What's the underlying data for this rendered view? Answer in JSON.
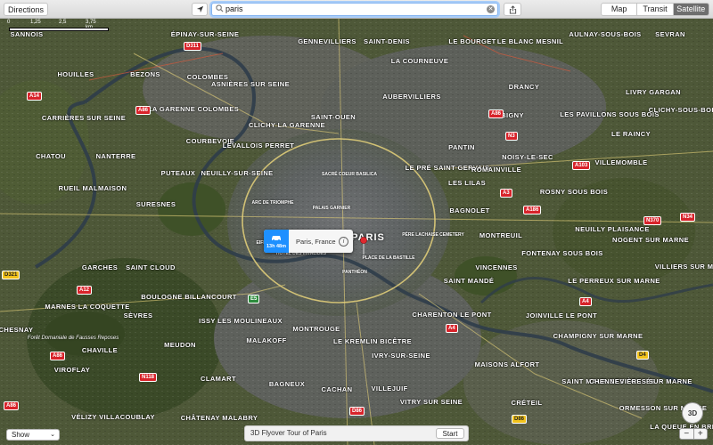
{
  "toolbar": {
    "directions_label": "Directions",
    "search_value": "paris",
    "map_types": [
      "Map",
      "Transit",
      "Satellite"
    ],
    "active_map_type": "Satellite"
  },
  "scale": {
    "ticks": [
      "0",
      "1,25",
      "2,5",
      "3,75 km"
    ]
  },
  "map": {
    "city_label": "PARIS",
    "places": [
      "SANNOIS",
      "GENNEVILLIERS",
      "SAINT-DENIS",
      "LE BOURGET",
      "LE BLANC MESNIL",
      "AULNAY-SOUS-BOIS",
      "SEVRAN",
      "ÉPINAY-SUR-SEINE",
      "HOUILLES",
      "BEZONS",
      "COLOMBES",
      "ASNIÈRES SUR SEINE",
      "LA COURNEUVE",
      "DRANCY",
      "LIVRY GARGAN",
      "AUBERVILLIERS",
      "BOBIGNY",
      "LES PAVILLONS SOUS BOIS",
      "CLICHY-SOUS-BOIS",
      "CARRIÈRES SUR SEINE",
      "LA GARENNE COLOMBES",
      "CLICHY LA GARENNE",
      "SAINT-OUEN",
      "LE RAINCY",
      "PANTIN",
      "NOISY-LE-SEC",
      "CHATOU",
      "NANTERRE",
      "COURBEVOIE",
      "LEVALLOIS PERRET",
      "LE PRÉ SAINT GERVAIS",
      "ROMAINVILLE",
      "VILLEMOMBLE",
      "RUEIL MALMAISON",
      "PUTEAUX",
      "NEUILLY-SUR-SEINE",
      "LES LILAS",
      "ROSNY SOUS BOIS",
      "SURESNES",
      "BAGNOLET",
      "NEUILLY PLAISANCE",
      "NOGENT SUR MARNE",
      "MONTREUIL",
      "FONTENAY SOUS BOIS",
      "GARCHES",
      "SAINT CLOUD",
      "VINCENNES",
      "VILLIERS SUR MARNE",
      "LE PERREUX SUR MARNE",
      "BOULOGNE BILLANCOURT",
      "SAINT MANDÉ",
      "MARNES LA COQUETTE",
      "SÈVRES",
      "ISSY LES MOULINEAUX",
      "CHARENTON LE PONT",
      "JOINVILLE LE PONT",
      "CHAMPIGNY SUR MARNE",
      "CHESNAY",
      "CHAVILLE",
      "MEUDON",
      "MALAKOFF",
      "MONTROUGE",
      "LE KREMLIN BICÊTRE",
      "IVRY-SUR-SEINE",
      "MAISONS ALFORT",
      "VIROFLAY",
      "CLAMART",
      "BAGNEUX",
      "CACHAN",
      "VILLEJUIF",
      "VITRY SUR SEINE",
      "CRÉTEIL",
      "SAINT MAUR DES FOSSÉS",
      "CHENNEVIÈRES SUR MARNE",
      "VÉLIZY VILLACOUBLAY",
      "CHÂTENAY MALABRY",
      "ORMESSON SUR MARNE",
      "LA QUEUE EN BRIE"
    ],
    "pois": [
      "SACRÉ COEUR BASILICA",
      "ARC DE TRIOMPHE",
      "PALAIS GARNIER",
      "EIFFEL TOWER",
      "HÔTEL DES INVALIDES",
      "PLACE DE LA BASTILLE",
      "PANTHÉON",
      "PÈRE LACHAISE CEMETERY"
    ],
    "park_label": "Forêt Domaniale de Fausses Reposes"
  },
  "callout": {
    "eta": "13h 48m",
    "place": "Paris, France"
  },
  "bottom": {
    "show_label": "Show",
    "flyover_label": "3D Flyover Tour of Paris",
    "start_label": "Start",
    "btn_3d": "3D",
    "zoom_out": "−",
    "zoom_in": "+"
  },
  "colors": {
    "accent": "#1e90ff",
    "pin": "#e0282e",
    "shield_red": "#d8232a",
    "shield_yellow": "#f1c21b"
  }
}
